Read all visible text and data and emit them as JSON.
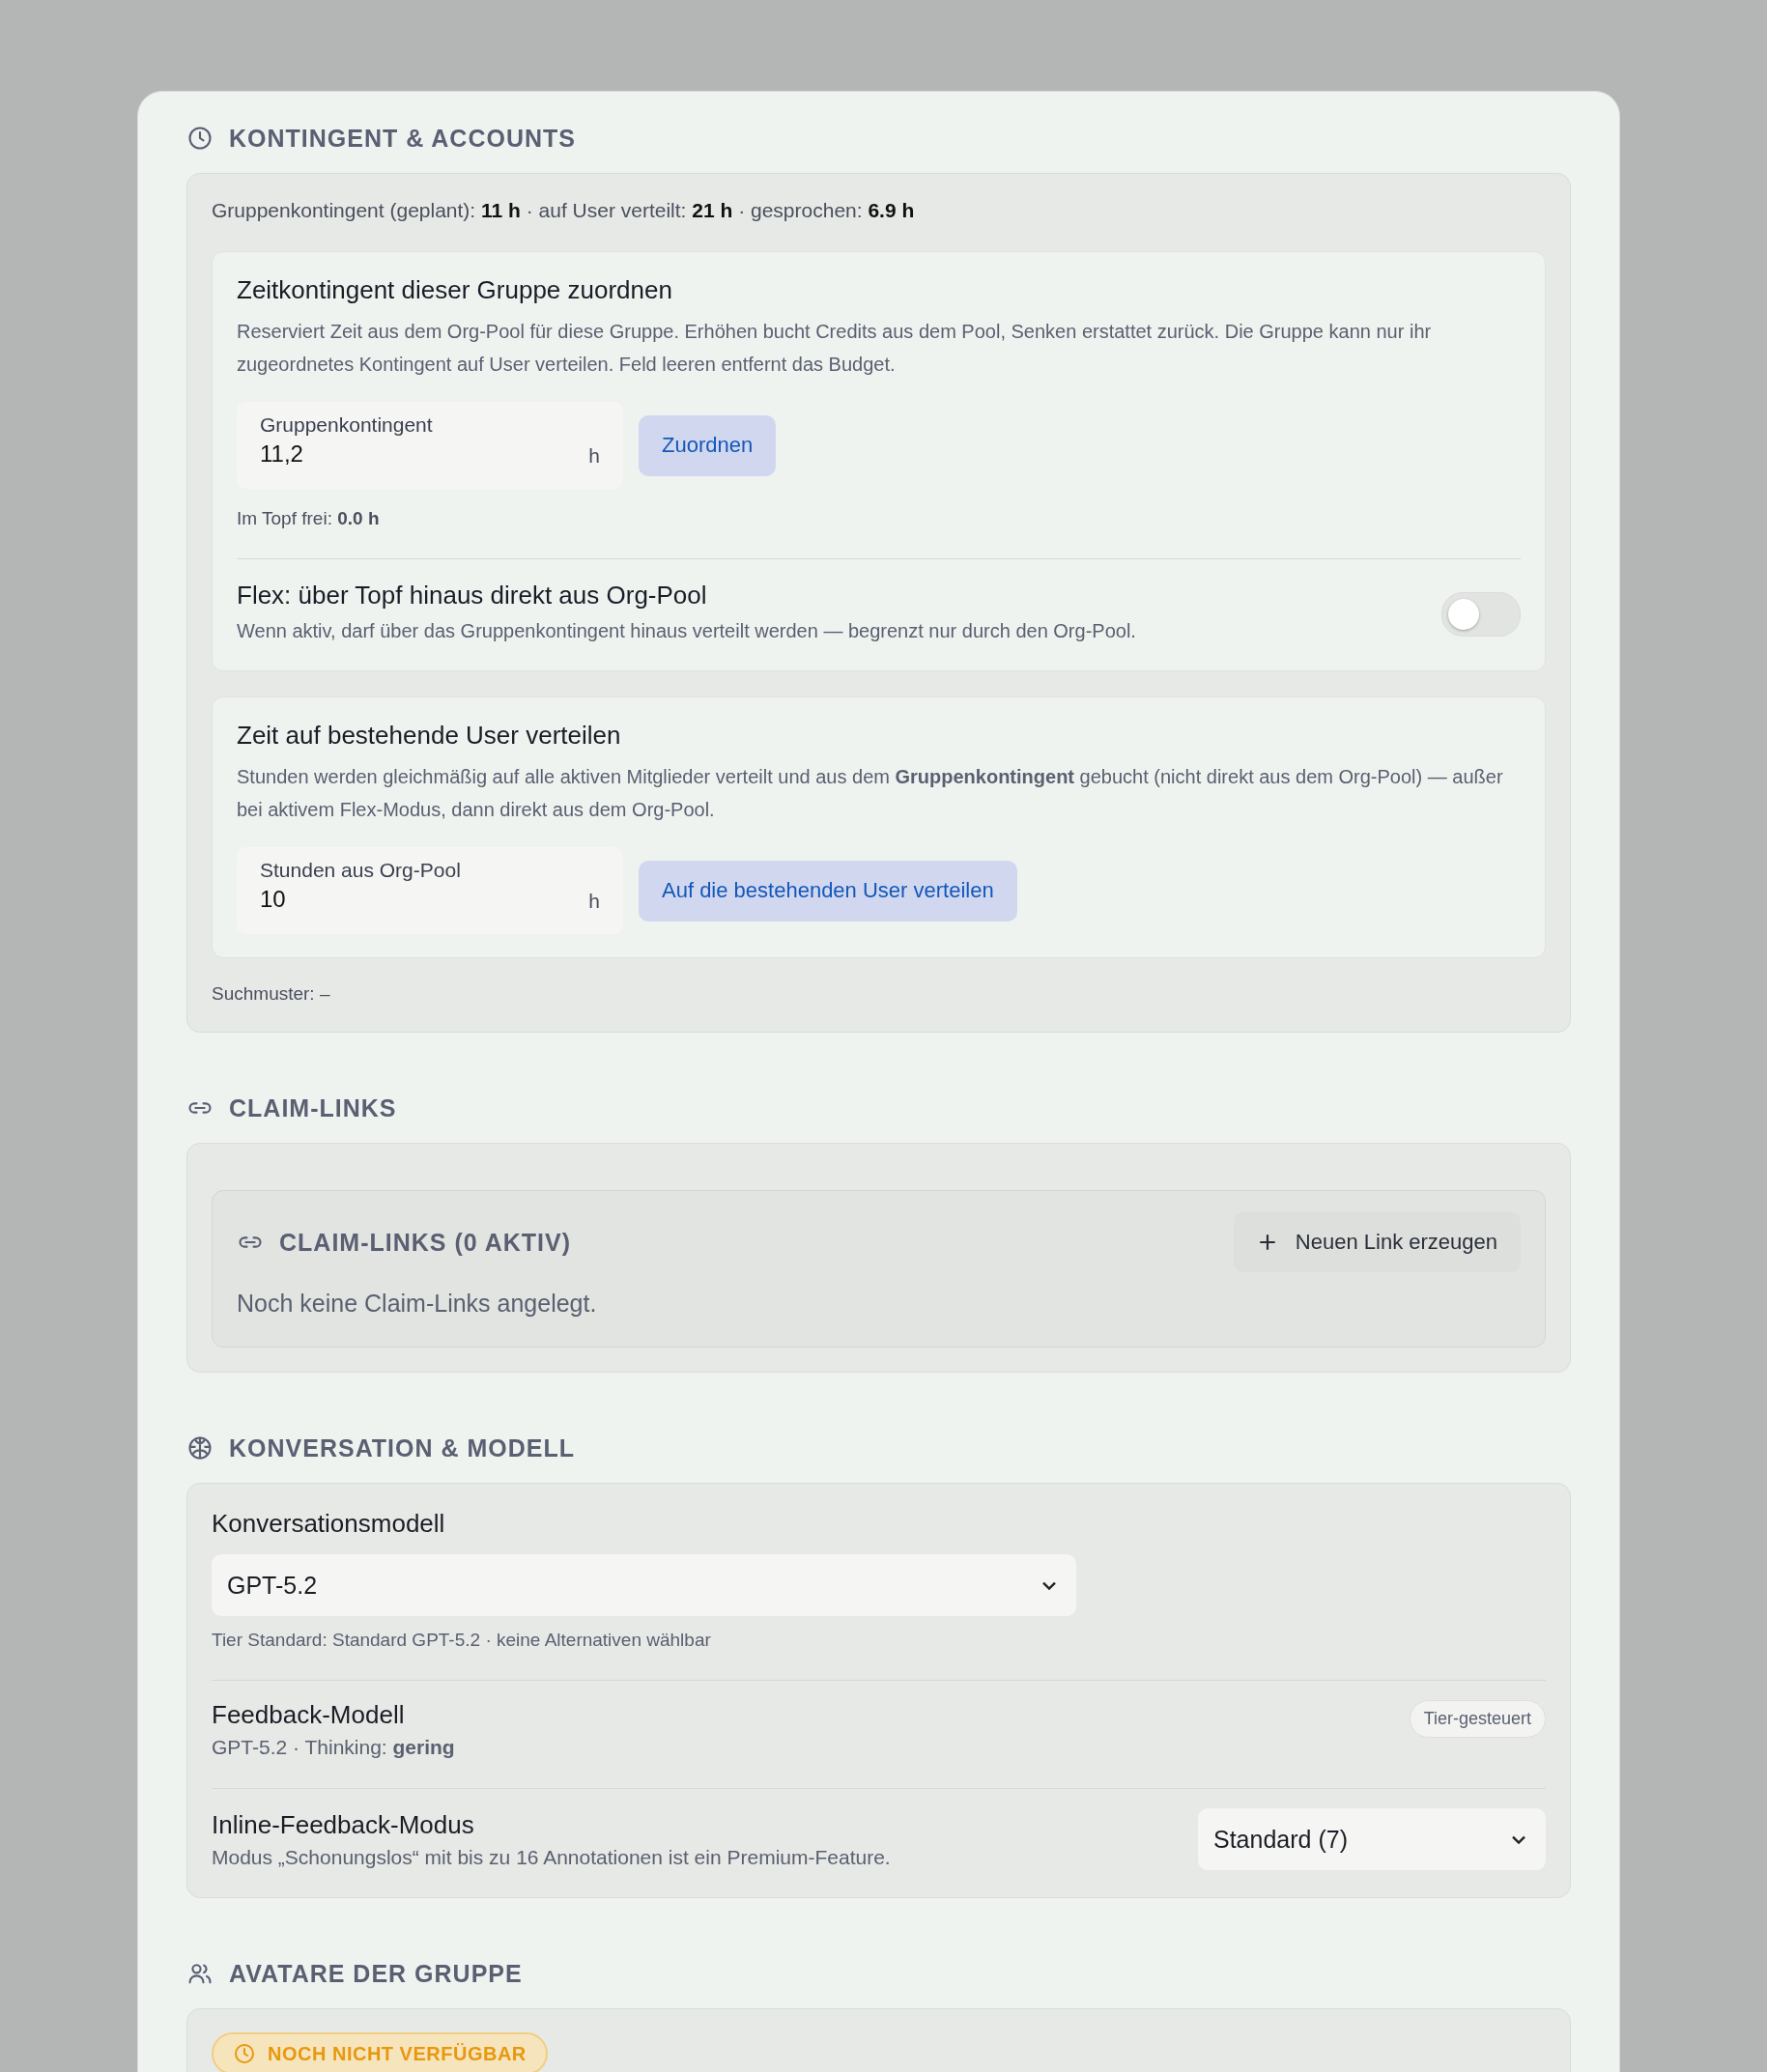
{
  "quota": {
    "title": "KONTINGENT & ACCOUNTS",
    "summary": "Gruppenkontingent (geplant): **11 h** · auf User verteilt: **21 h** · gesprochen: **6.9 h**",
    "assign": {
      "title": "Zeitkontingent dieser Gruppe zuordnen",
      "description": "Reserviert Zeit aus dem Org-Pool für diese Gruppe. Erhöhen bucht Credits aus dem Pool, Senken erstattet zurück. Die Gruppe kann nur ihr zugeordnetes Kontingent auf User verteilen. Feld leeren entfernt das Budget.",
      "field_label": "Gruppenkontingent",
      "value": "11,2",
      "unit": "h",
      "button": "Zuordnen",
      "pot_free": "Im Topf frei: **0.0 h**"
    },
    "flex": {
      "title": "Flex: über Topf hinaus direkt aus Org-Pool",
      "description": "Wenn aktiv, darf über das Gruppenkontingent hinaus verteilt werden — begrenzt nur durch den Org-Pool.",
      "on": false
    },
    "distribute": {
      "title": "Zeit auf bestehende User verteilen",
      "description": "Stunden werden gleichmäßig auf alle aktiven Mitglieder verteilt und aus dem **Gruppenkontingent** gebucht (nicht direkt aus dem Org-Pool) — außer bei aktivem Flex-Modus, dann direkt aus dem Org-Pool.",
      "field_label": "Stunden aus Org-Pool",
      "value": "10",
      "unit": "h",
      "button": "Auf die bestehenden User verteilen"
    },
    "search_pattern": "Suchmuster: –"
  },
  "claim_links": {
    "title": "CLAIM-LINKS",
    "box_title": "CLAIM-LINKS (0 AKTIV)",
    "new_button": "Neuen Link erzeugen",
    "empty": "Noch keine Claim-Links angelegt."
  },
  "conversation": {
    "title": "KONVERSATION & MODELL",
    "model_label": "Konversationsmodell",
    "model_value": "GPT-5.2",
    "model_hint": "Tier Standard: Standard GPT-5.2 · keine Alternativen wählbar",
    "feedback_title": "Feedback-Modell",
    "feedback_detail": "GPT-5.2 · Thinking: **gering**",
    "feedback_badge": "Tier-gesteuert",
    "inline_title": "Inline-Feedback-Modus",
    "inline_detail": "Modus „Schonungslos“ mit bis zu 16 Annotationen ist ein Premium-Feature.",
    "inline_value": "Standard (7)"
  },
  "avatars": {
    "title": "AVATARE DER GRUPPE",
    "badge": "NOCH NICHT VERFÜGBAR"
  }
}
